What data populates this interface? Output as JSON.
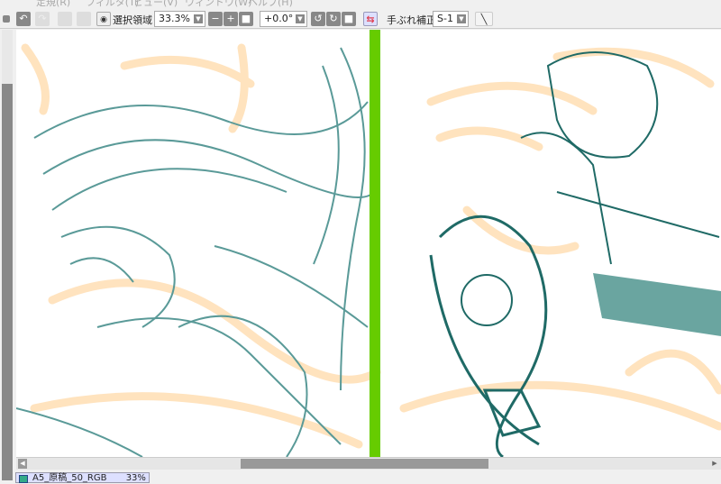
{
  "menu": [
    "定規(R)",
    "フィルタ(T)",
    "ビュー(V)",
    "ウィンドウ(W)",
    "ヘルプ(H)"
  ],
  "toolbar": {
    "selection_label": "選択領域",
    "zoom_value": "33.3%",
    "rotation_value": "+0.0°",
    "stabilizer_label": "手ぶれ補正",
    "stabilizer_value": "S-1"
  },
  "document_tab": {
    "label": "A5_原稿_50_RGB",
    "zoom": "33%"
  },
  "colors": {
    "line": "#5a9a98",
    "dark_line": "#1f6a66",
    "sketch": "#ffe0b8",
    "divider": "#66cc00",
    "flip_button": "#e04050"
  }
}
